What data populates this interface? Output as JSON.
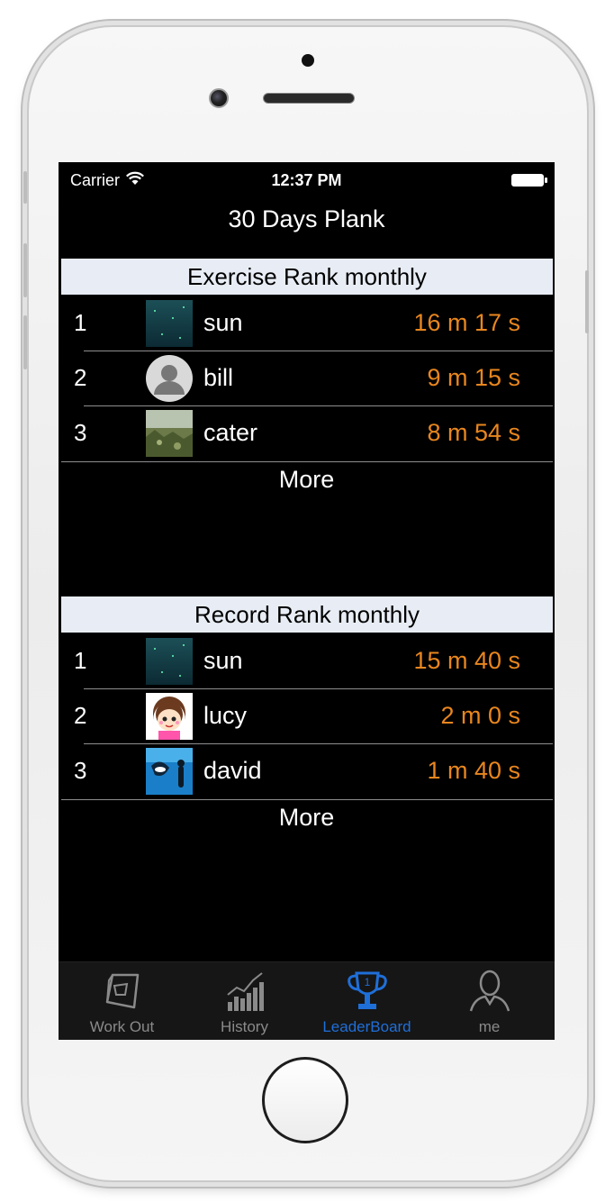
{
  "status_bar": {
    "carrier": "Carrier",
    "time": "12:37 PM"
  },
  "nav": {
    "title": "30 Days Plank"
  },
  "exercise_section": {
    "header": "Exercise Rank monthly",
    "rows": [
      {
        "rank": "1",
        "name": "sun",
        "time": "16 m 17 s",
        "avatar": "sea-photo"
      },
      {
        "rank": "2",
        "name": "bill",
        "time": "9 m 15 s",
        "avatar": "default-user-silhouette"
      },
      {
        "rank": "3",
        "name": "cater",
        "time": "8 m 54 s",
        "avatar": "grass-photo"
      }
    ],
    "more_label": "More"
  },
  "record_section": {
    "header": "Record Rank monthly",
    "rows": [
      {
        "rank": "1",
        "name": "sun",
        "time": "15 m 40 s",
        "avatar": "sea-photo"
      },
      {
        "rank": "2",
        "name": "lucy",
        "time": "2 m 0 s",
        "avatar": "cartoon-girl"
      },
      {
        "rank": "3",
        "name": "david",
        "time": "1 m 40 s",
        "avatar": "aquarium-photo"
      }
    ],
    "more_label": "More"
  },
  "tab_bar": {
    "tabs": [
      {
        "label": "Work Out",
        "icon": "whistle-icon",
        "active": false
      },
      {
        "label": "History",
        "icon": "bar-chart-icon",
        "active": false
      },
      {
        "label": "LeaderBoard",
        "icon": "trophy-icon",
        "active": true
      },
      {
        "label": "me",
        "icon": "person-icon",
        "active": false
      }
    ]
  },
  "colors": {
    "time_text": "#e8861e",
    "active_tab": "#1f6fd9",
    "section_header_bg": "#e8edf5"
  }
}
